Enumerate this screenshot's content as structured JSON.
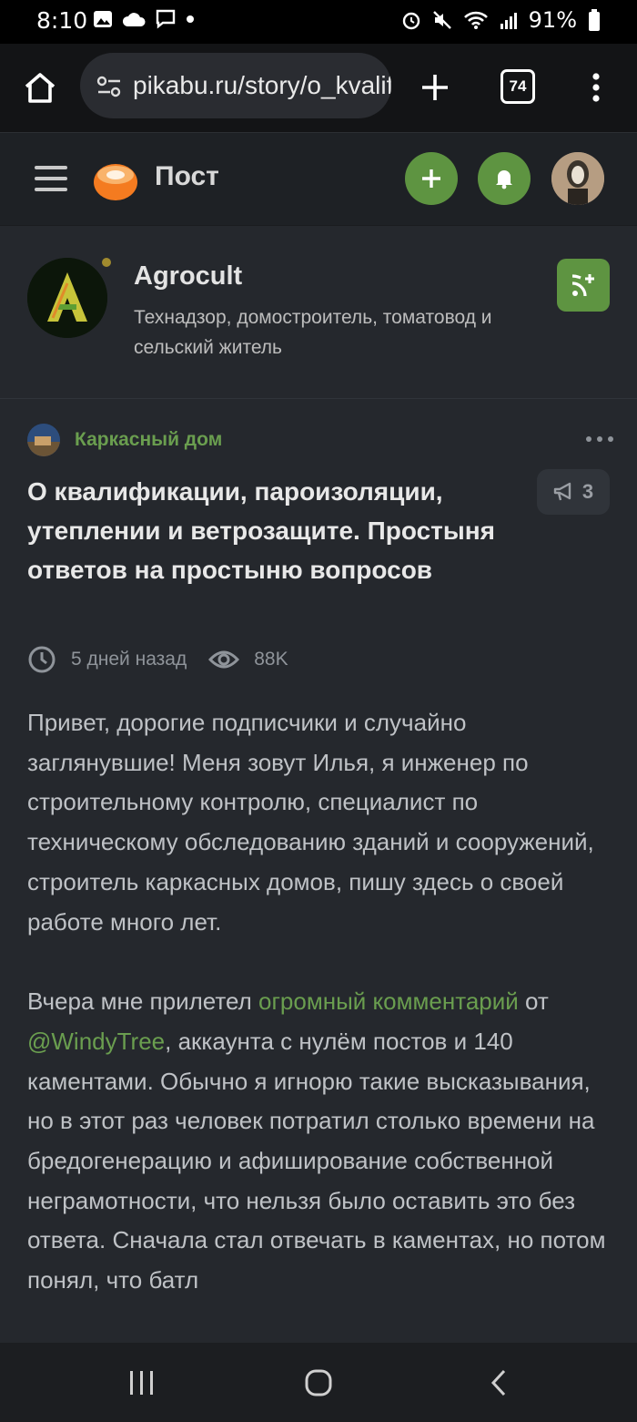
{
  "status_bar": {
    "time": "8:10",
    "battery": "91%",
    "left_icons": [
      "image-icon",
      "cloud-icon",
      "chat-icon",
      "dot-icon"
    ],
    "right_icons": [
      "alarm-icon",
      "mute-icon",
      "wifi-icon",
      "signal-icon",
      "battery-icon"
    ]
  },
  "browser": {
    "url": "pikabu.ru/story/o_kvalifikatsii",
    "tabs_count": "74"
  },
  "header": {
    "title": "Пост"
  },
  "author": {
    "name": "Agrocult",
    "description": "Технадзор, домостроитель, томатовод и сельский житель"
  },
  "post": {
    "community": "Каркасный дом",
    "title": "О квалификации, пароизоляции, утеплении и ветрозащите. Простыня ответов на простыню вопросов",
    "comments": "3",
    "time": "5 дней назад",
    "views": "88K",
    "p1": "Привет, дорогие подписчики и случайно заглянувшие! Меня зовут Илья, я инженер по строительному контролю, специалист по техническому обследованию зданий и сооружений, строитель каркасных домов, пишу здесь о своей работе много лет.",
    "p2_a": "Вчера мне прилетел ",
    "p2_link1": "огромный комментарий",
    "p2_b": " от ",
    "p2_link2": "@WindyTree",
    "p2_c": ", аккаунта с нулём постов и 140 каментами. Обычно я игнорю такие высказывания, но в этот раз человек потратил столько времени на бредогенерацию и афиширование собственной неграмотности, что нельзя было оставить это без ответа. Сначала стал отвечать в каментах, но потом понял, что батл"
  },
  "colors": {
    "accent_green": "#5e9441",
    "link_green": "#6a9e4f",
    "background": "#25282d"
  }
}
